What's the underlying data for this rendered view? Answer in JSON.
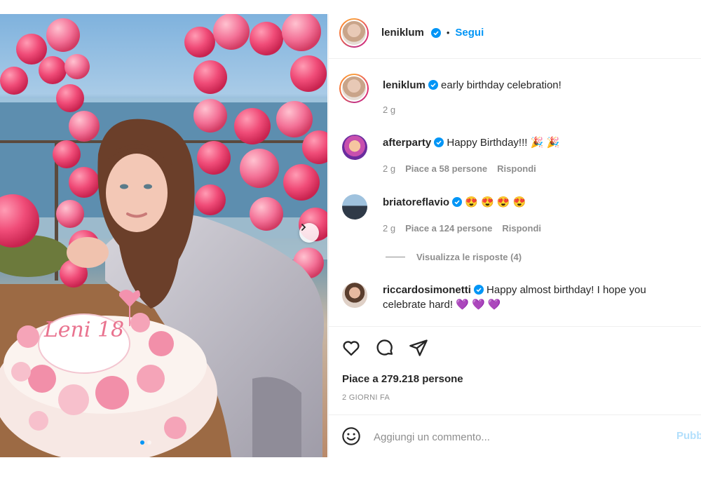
{
  "post": {
    "author": "leniklum",
    "follow_separator": "•",
    "follow_label": "Segui",
    "caption": {
      "username": "leniklum",
      "text": "early birthday celebration!",
      "time": "2 g"
    },
    "cake_text": "Leni 18",
    "comments": [
      {
        "username": "afterparty",
        "text": "Happy Birthday!!! 🎉 🎉",
        "time": "2 g",
        "likes": "Piace a 58 persone",
        "reply": "Rispondi"
      },
      {
        "username": "briatoreflavio",
        "text": "😍 😍 😍 😍",
        "time": "2 g",
        "likes": "Piace a 124 persone",
        "reply": "Rispondi"
      },
      {
        "username": "riccardosimonetti",
        "text": "Happy almost birthday! I hope you celebrate hard! 💜 💜 💜"
      }
    ],
    "view_replies": "Visualizza le risposte (4)",
    "likes_total": "Piace a 279.218 persone",
    "date": "2 GIORNI FA",
    "comment_placeholder": "Aggiungi un commento...",
    "publish_label": "Pubb"
  },
  "icons": {
    "verified": "verified-badge-icon",
    "like": "heart-icon",
    "comment": "speech-bubble-icon",
    "share": "paper-plane-icon",
    "emoji": "smiley-icon",
    "next": "chevron-right-icon"
  },
  "colors": {
    "link_blue": "#0095f6",
    "publish_disabled": "#b2dffc",
    "muted_text": "#8e8e8e",
    "divider": "#efefef",
    "heart_emoji": "#9b59d0"
  }
}
